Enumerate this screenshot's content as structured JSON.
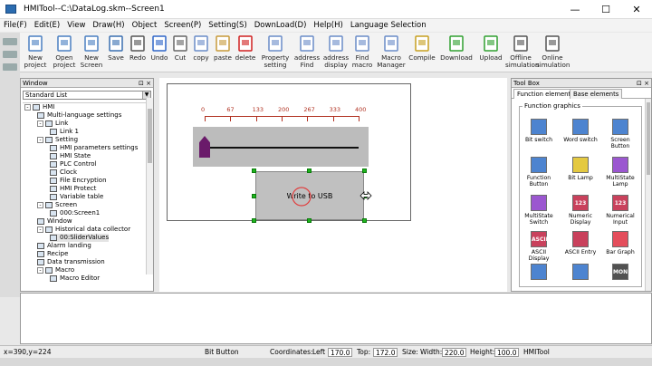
{
  "window": {
    "title": "HMITool--C:\\DataLog.skm--Screen1",
    "minimize": "—",
    "maximize": "☐",
    "close": "✕"
  },
  "menu": [
    "File(F)",
    "Edit(E)",
    "View",
    "Draw(H)",
    "Object",
    "Screen(P)",
    "Setting(S)",
    "DownLoad(D)",
    "Help(H)",
    "Language Selection"
  ],
  "toolbar": [
    {
      "label": "New project",
      "icon": "new-project-icon",
      "color": "#4a7fc1"
    },
    {
      "label": "Open project",
      "icon": "open-project-icon",
      "color": "#4a7fc1"
    },
    {
      "label": "New Screen",
      "icon": "new-screen-icon",
      "color": "#4a7fc1"
    },
    {
      "label": "Save",
      "icon": "save-icon",
      "color": "#3a6fb0"
    },
    {
      "label": "Redo",
      "icon": "redo-icon",
      "color": "#555555"
    },
    {
      "label": "Undo",
      "icon": "undo-icon",
      "color": "#2f66c8"
    },
    {
      "label": "Cut",
      "icon": "cut-icon",
      "color": "#666666"
    },
    {
      "label": "copy",
      "icon": "copy-icon",
      "color": "#6a8cc8"
    },
    {
      "label": "paste",
      "icon": "paste-icon",
      "color": "#c79a3a"
    },
    {
      "label": "delete",
      "icon": "delete-icon",
      "color": "#d02020"
    },
    {
      "label": "Property setting",
      "icon": "property-icon",
      "color": "#6a8cc8"
    },
    {
      "label": "address Find",
      "icon": "address-find-icon",
      "color": "#6a8cc8"
    },
    {
      "label": "address display",
      "icon": "address-display-icon",
      "color": "#6a8cc8"
    },
    {
      "label": "Find macro",
      "icon": "find-macro-icon",
      "color": "#6a8cc8"
    },
    {
      "label": "Macro Manager",
      "icon": "macro-manager-icon",
      "color": "#6a8cc8"
    },
    {
      "label": "Compile",
      "icon": "compile-icon",
      "color": "#c7a020"
    },
    {
      "label": "Download",
      "icon": "download-icon",
      "color": "#30a030"
    },
    {
      "label": "Upload",
      "icon": "upload-icon",
      "color": "#30a030"
    },
    {
      "label": "Offline simulation",
      "icon": "offline-sim-icon",
      "color": "#555555"
    },
    {
      "label": "Online simulation",
      "icon": "online-sim-icon",
      "color": "#555555"
    }
  ],
  "window_panel": {
    "title": "Window",
    "buttons": "⊡ ×",
    "list_type": "Standard List",
    "tree": [
      {
        "label": "HMI",
        "level": 0,
        "toggle": "-"
      },
      {
        "label": "Multi-language settings",
        "level": 1,
        "toggle": ""
      },
      {
        "label": "Link",
        "level": 1,
        "toggle": "-"
      },
      {
        "label": "Link 1",
        "level": 2,
        "toggle": ""
      },
      {
        "label": "Setting",
        "level": 1,
        "toggle": "-"
      },
      {
        "label": "HMI parameters settings",
        "level": 2,
        "toggle": ""
      },
      {
        "label": "HMI State",
        "level": 2,
        "toggle": ""
      },
      {
        "label": "PLC Control",
        "level": 2,
        "toggle": ""
      },
      {
        "label": "Clock",
        "level": 2,
        "toggle": ""
      },
      {
        "label": "File Encryption",
        "level": 2,
        "toggle": ""
      },
      {
        "label": "HMI Protect",
        "level": 2,
        "toggle": ""
      },
      {
        "label": "Variable table",
        "level": 2,
        "toggle": ""
      },
      {
        "label": "Screen",
        "level": 1,
        "toggle": "-"
      },
      {
        "label": "000:Screen1",
        "level": 2,
        "toggle": ""
      },
      {
        "label": "Window",
        "level": 1,
        "toggle": ""
      },
      {
        "label": "Historical data collector",
        "level": 1,
        "toggle": "-"
      },
      {
        "label": "00:SliderValues",
        "level": 2,
        "toggle": "",
        "selected": true
      },
      {
        "label": "Alarm landing",
        "level": 1,
        "toggle": ""
      },
      {
        "label": "Recipe",
        "level": 1,
        "toggle": ""
      },
      {
        "label": "Data transmission",
        "level": 1,
        "toggle": ""
      },
      {
        "label": "Macro",
        "level": 1,
        "toggle": "-"
      },
      {
        "label": "Macro Editor",
        "level": 2,
        "toggle": ""
      }
    ]
  },
  "canvas": {
    "slider_scale": [
      "0",
      "67",
      "133",
      "200",
      "267",
      "333",
      "400"
    ],
    "slider_value_fraction": 0,
    "write_button_label": "Write to USB",
    "scale_color": "#b03020",
    "knob_color": "#6a1a6a"
  },
  "toolbox": {
    "title": "Tool Box",
    "buttons": "⊡ ×",
    "tabs": [
      "Function elements",
      "Base elements"
    ],
    "group_title": "Function graphics",
    "tools": [
      {
        "label": "Bit switch",
        "icon": "bit-switch-icon",
        "color": "#2f6fc8"
      },
      {
        "label": "Word switch",
        "icon": "word-switch-icon",
        "color": "#2f6fc8"
      },
      {
        "label": "Screen Button",
        "icon": "screen-button-icon",
        "color": "#2f6fc8"
      },
      {
        "label": "Function Button",
        "icon": "function-button-icon",
        "color": "#2f6fc8"
      },
      {
        "label": "Bit Lamp",
        "icon": "bit-lamp-icon",
        "color": "#e0c020"
      },
      {
        "label": "MultiState Lamp",
        "icon": "multistate-lamp-icon",
        "color": "#8a3ac8"
      },
      {
        "label": "MultiState Switch",
        "icon": "multistate-switch-icon",
        "color": "#8a3ac8"
      },
      {
        "label": "Numeric Display",
        "icon": "numeric-display-icon",
        "color": "#c02040"
      },
      {
        "label": "Numerical Input",
        "icon": "numerical-input-icon",
        "color": "#c02040"
      },
      {
        "label": "ASCII Display",
        "icon": "ascii-display-icon",
        "color": "#c02040"
      },
      {
        "label": "ASCII Entry",
        "icon": "ascii-entry-icon",
        "color": "#c02040"
      },
      {
        "label": "Bar Graph",
        "icon": "bar-graph-icon",
        "color": "#e03040"
      },
      {
        "label": "",
        "icon": "clock-tool-icon",
        "color": "#2f6fc8"
      },
      {
        "label": "",
        "icon": "calendar-tool-icon",
        "color": "#2f6fc8"
      },
      {
        "label": "",
        "icon": "weekday-tool-icon",
        "color": "#333333"
      }
    ],
    "tool_texts": {
      "bit-switch-icon": "",
      "numeric-display-icon": "123",
      "numerical-input-icon": "123",
      "ascii-display-icon": "ASCII",
      "weekday-tool-icon": "MON"
    }
  },
  "status": {
    "cursor": "x=390,y=224",
    "object": "Bit Button",
    "coordinates_label": "Coordinates:",
    "left_label": "Left",
    "left": "170.0",
    "top_label": "Top:",
    "top": "172.0",
    "size_label": "Size:",
    "width_label": "Width:",
    "width": "220.0",
    "height_label": "Height:",
    "height": "100.0",
    "app": "HMITool"
  }
}
